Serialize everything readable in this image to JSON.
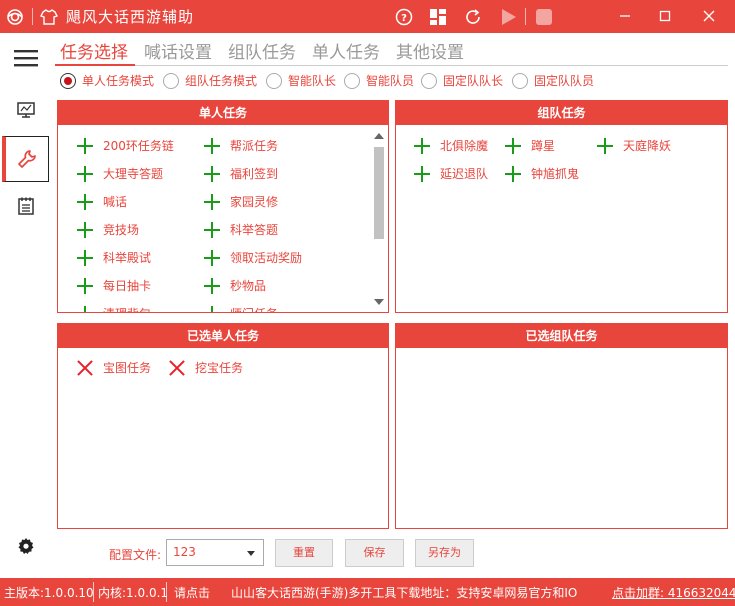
{
  "window": {
    "title": "飓风大话西游辅助",
    "accent": "#e8453c"
  },
  "titlebar_icons": [
    "app-logo-icon",
    "shirt-icon",
    "help-icon",
    "dashboard-icon",
    "refresh-icon",
    "play-icon",
    "stop-icon"
  ],
  "sidebar": {
    "items": [
      "monitor-icon",
      "wrench-icon",
      "notebook-icon"
    ],
    "settings": "gear-icon"
  },
  "tabs": [
    {
      "label": "任务选择",
      "active": true
    },
    {
      "label": "喊话设置"
    },
    {
      "label": "组队任务"
    },
    {
      "label": "单人任务"
    },
    {
      "label": "其他设置"
    }
  ],
  "modes": [
    {
      "label": "单人任务模式",
      "checked": true
    },
    {
      "label": "组队任务模式"
    },
    {
      "label": "智能队长"
    },
    {
      "label": "智能队员"
    },
    {
      "label": "固定队队长"
    },
    {
      "label": "固定队队员"
    }
  ],
  "single_tasks": {
    "title": "单人任务",
    "col1": [
      "200环任务链",
      "大理寺答题",
      "喊话",
      "竞技场",
      "科举殿试",
      "每日抽卡",
      "清理背包"
    ],
    "col2": [
      "帮派任务",
      "福利签到",
      "家园灵修",
      "科举答题",
      "领取活动奖励",
      "秒物品",
      "师门任务"
    ]
  },
  "team_tasks": {
    "title": "组队任务",
    "items": [
      "北俱除魔",
      "蹲星",
      "天庭降妖",
      "延迟退队",
      "钟馗抓鬼"
    ]
  },
  "selected_single": {
    "title": "已选单人任务",
    "items": [
      "宝图任务",
      "挖宝任务"
    ]
  },
  "selected_team": {
    "title": "已选组队任务"
  },
  "config": {
    "label": "配置文件:",
    "value": "123",
    "reset": "重置",
    "save": "保存",
    "save_as": "另存为"
  },
  "status": {
    "main_version": "主版本:1.0.0.10",
    "core_version": "内核:1.0.0.1",
    "click": "请点击",
    "download": "山山客大话西游(手游)多开工具下载地址：支持安卓网易官方和IO",
    "join_group": "点击加群: 416632044"
  }
}
